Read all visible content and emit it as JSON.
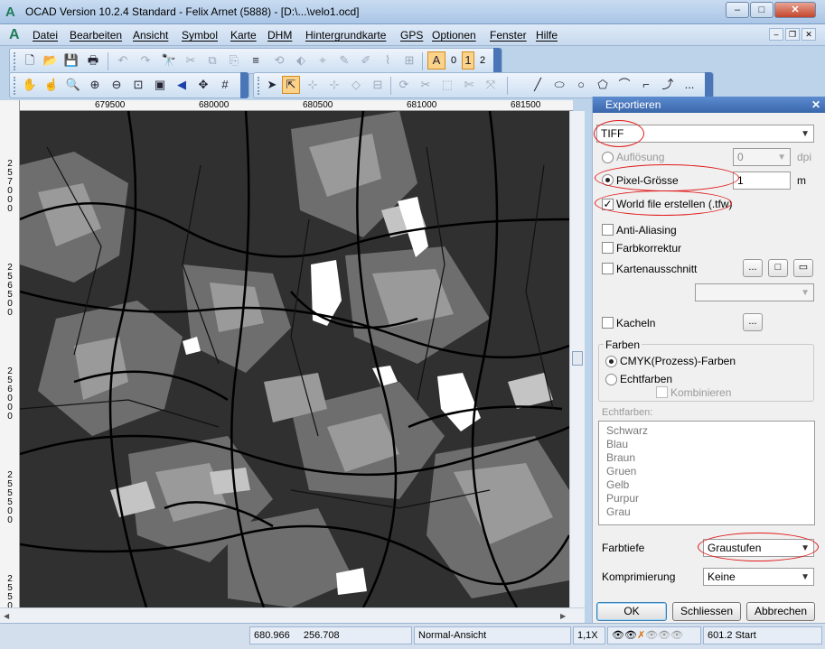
{
  "window": {
    "title": "OCAD Version 10.2.4  Standard - Felix Arnet (5888) - [D:\\...\\velo1.ocd]",
    "logo_glyph": "A",
    "minimize": "–",
    "maximize": "□",
    "close": "✕"
  },
  "menu": {
    "items": [
      "Datei",
      "Bearbeiten",
      "Ansicht",
      "Symbol",
      "Karte",
      "DHM",
      "Hintergrundkarte",
      "GPS",
      "Optionen",
      "Fenster",
      "Hilfe"
    ],
    "mdi_minimize": "–",
    "mdi_restore": "❐",
    "mdi_close": "✕"
  },
  "toolbar1": {
    "icons": [
      "new-icon",
      "open-icon",
      "save-icon",
      "print-icon",
      "undo-icon",
      "redo-icon",
      "find-icon",
      "cut-icon",
      "copy-icon",
      "paste-icon",
      "duplicate-icon",
      "reshape-icon",
      "fill-icon",
      "pin-icon",
      "brush-icon",
      "smooth-icon",
      "grid-icon",
      "layer-a-icon"
    ],
    "num_0": "0",
    "num_1": "1",
    "num_2": "2"
  },
  "toolbar2": {
    "icons": [
      "hand-icon",
      "hand-scroll-icon",
      "zoom-in-icon",
      "zoom-plus-icon",
      "zoom-out-icon",
      "zoom-select-icon",
      "zoom-fit-icon",
      "arrow-left-icon",
      "move-icon",
      "hash-icon",
      "pointer-icon",
      "edit-object-icon",
      "edit-point-icon",
      "add-point-icon",
      "remove-point-icon",
      "corner-point-icon",
      "rotate-icon",
      "cut-object-icon",
      "cut-hole-icon",
      "merge-icon",
      "line-icon",
      "ellipse-icon",
      "circle-icon",
      "polygon-icon",
      "curve-icon",
      "straight-line-icon",
      "freehand-icon",
      "more-icon"
    ],
    "more": "..."
  },
  "ruler": {
    "x_labels": [
      "679500",
      "680000",
      "680500",
      "681000",
      "681500"
    ],
    "y_labels": [
      "257000",
      "256500",
      "256000",
      "255500",
      "255000"
    ]
  },
  "status": {
    "coords_x": "680.966",
    "coords_y": "256.708",
    "view_mode": "Normal-Ansicht",
    "zoom": "1,1X",
    "start": "601.2 Start"
  },
  "panel": {
    "header": "Exportieren",
    "format": "TIFF",
    "aufloesung_label": "Auflösung",
    "aufloesung_value": "0",
    "aufloesung_unit": "dpi",
    "pixel_label": "Pixel-Grösse",
    "pixel_value": "1",
    "pixel_unit": "m",
    "worldfile_label": "World file erstellen (.tfw)",
    "anti_aliasing_label": "Anti-Aliasing",
    "farbkorrektur_label": "Farbkorrektur",
    "kartenausschnitt_label": "Kartenausschnitt",
    "kacheln_label": "Kacheln",
    "dots": "...",
    "farben_group": "Farben",
    "cmyk_label": "CMYK(Prozess)-Farben",
    "echtfarben_label": "Echtfarben",
    "kombinieren_label": "Kombinieren",
    "echtfarben_list_label": "Echtfarben:",
    "echtfarben_list": [
      "Schwarz",
      "Blau",
      "Braun",
      "Gruen",
      "Gelb",
      "Purpur",
      "Grau"
    ],
    "farbtiefe_label": "Farbtiefe",
    "farbtiefe_value": "Graustufen",
    "komprimierung_label": "Komprimierung",
    "komprimierung_value": "Keine",
    "ok": "OK",
    "schliessen": "Schliessen",
    "abbrechen": "Abbrechen"
  }
}
